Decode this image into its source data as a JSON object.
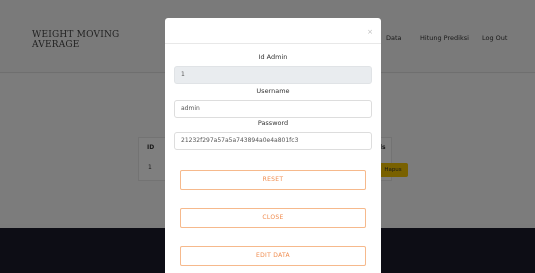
{
  "brand": {
    "line1": "WEIGHT MOVING",
    "line2": "AVERAGE"
  },
  "nav": {
    "data": "Data",
    "hitung": "Hitung Prediksi",
    "logout": "Log Out"
  },
  "table": {
    "col_id": "ID",
    "col_aksi": "ls",
    "row_id": "1",
    "hapus_label": "Hapus"
  },
  "modal": {
    "close": "×",
    "id_label": "Id Admin",
    "id_value": "1",
    "username_label": "Username",
    "username_value": "admin",
    "password_label": "Password",
    "password_value": "21232f297a57a5a743894a0e4a801fc3",
    "reset_label": "RESET",
    "close_label": "CLOSE",
    "edit_label": "EDIT DATA"
  },
  "colors": {
    "accent": "#f08a4b",
    "hapus": "#f2c200",
    "footer": "#1b1b2b"
  }
}
